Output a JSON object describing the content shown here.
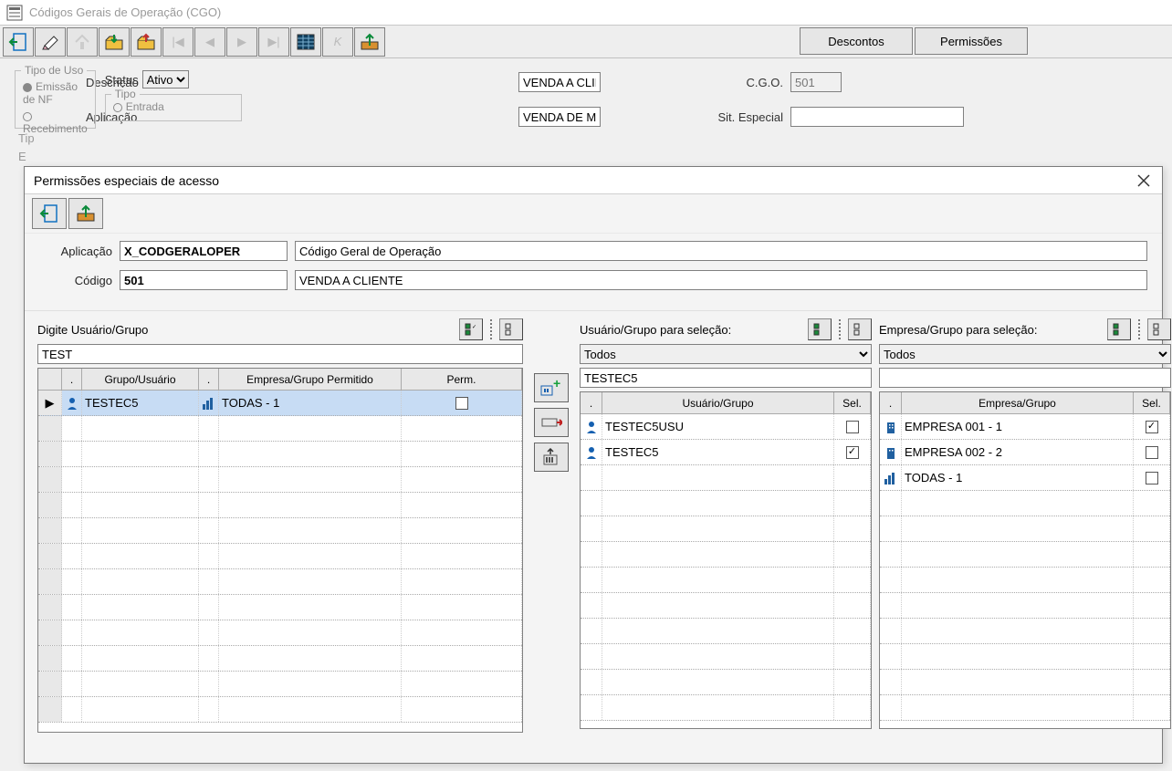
{
  "window": {
    "title": "Códigos Gerais de Operação (CGO)"
  },
  "toolbar": {
    "btn_descontos": "Descontos",
    "btn_permissoes": "Permissões"
  },
  "form": {
    "descricao_label": "Descrição",
    "descricao_value": "VENDA A CLIENTE",
    "aplicacao_label": "Aplicação",
    "aplicacao_value": "VENDA DE MERCADORIA A CLIENTES",
    "cgo_label": "C.G.O.",
    "cgo_value": "501",
    "sit_label": "Sit. Especial",
    "sit_value": "",
    "tipo_uso_label": "Tipo de Uso",
    "tipo_uso_opt1": "Emissão de NF",
    "tipo_uso_opt2": "Recebimento",
    "status_label": "Status",
    "status_value": "Ativo",
    "tipo_label": "Tipo",
    "tipo_partial": "Entrada",
    "tip_truncated": "Tip",
    "e_truncated": "E"
  },
  "modal": {
    "title": "Permissões especiais de acesso",
    "hdr": {
      "aplicacao_label": "Aplicação",
      "aplicacao_code": "X_CODGERALOPER",
      "aplicacao_desc": "Código Geral de Operação",
      "codigo_label": "Código",
      "codigo_value": "501",
      "codigo_desc": "VENDA A CLIENTE"
    },
    "left": {
      "label": "Digite Usuário/Grupo",
      "input_value": "TEST",
      "cols": {
        "c1": ".",
        "c2": "Grupo/Usuário",
        "c3": ".",
        "c4": "Empresa/Grupo Permitido",
        "c5": "Perm."
      },
      "rows": [
        {
          "icon": "person",
          "usuario": "TESTEC5",
          "icon2": "bars",
          "empresa": "TODAS - 1",
          "perm": false
        }
      ]
    },
    "mid": {
      "label": "Usuário/Grupo para seleção:",
      "combo": "Todos",
      "search": "TESTEC5",
      "cols": {
        "c1": ".",
        "c2": "Usuário/Grupo",
        "c3": "Sel."
      },
      "rows": [
        {
          "icon": "person",
          "name": "TESTEC5USU",
          "sel": false
        },
        {
          "icon": "person",
          "name": "TESTEC5",
          "sel": true
        }
      ]
    },
    "right": {
      "label": "Empresa/Grupo para seleção:",
      "combo": "Todos",
      "search": "",
      "cols": {
        "c1": ".",
        "c2": "Empresa/Grupo",
        "c3": "Sel."
      },
      "rows": [
        {
          "icon": "building",
          "name": "EMPRESA 001 - 1",
          "sel": true
        },
        {
          "icon": "building",
          "name": "EMPRESA 002 - 2",
          "sel": false
        },
        {
          "icon": "bars",
          "name": "TODAS - 1",
          "sel": false
        }
      ]
    }
  }
}
